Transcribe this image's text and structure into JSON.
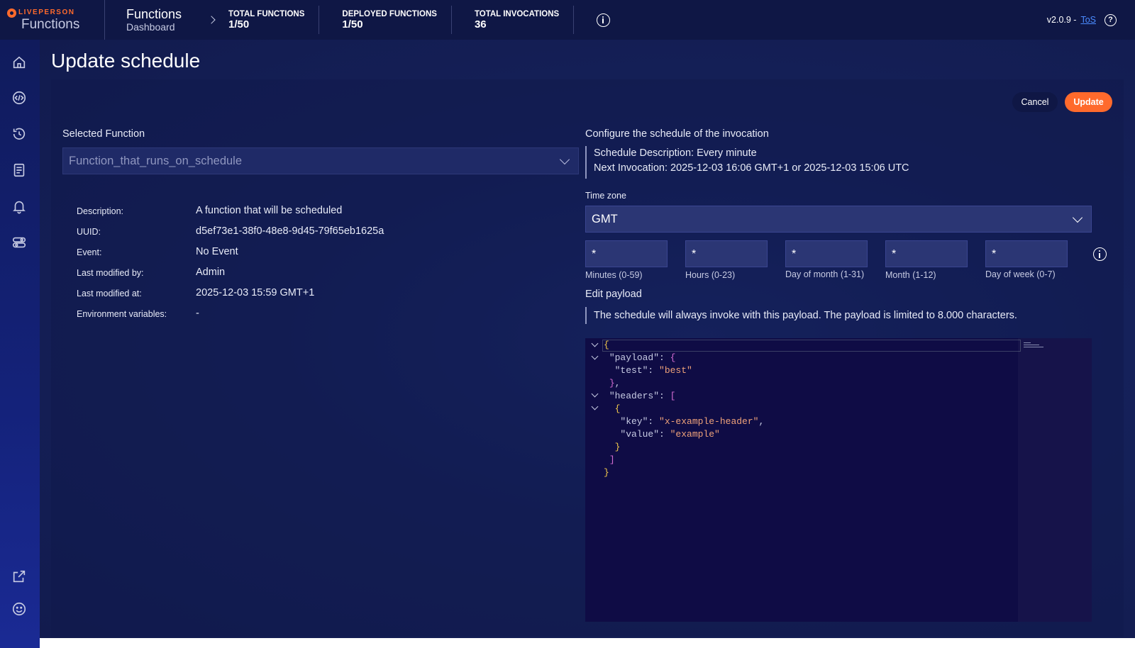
{
  "app": {
    "brand_word": "LIVEPERSON",
    "brand_name": "Functions",
    "version": "v2.0.9 -",
    "tos_label": "ToS"
  },
  "breadcrumb": {
    "title": "Functions",
    "subtitle": "Dashboard"
  },
  "stats": [
    {
      "label": "TOTAL FUNCTIONS",
      "value": "1/50"
    },
    {
      "label": "DEPLOYED FUNCTIONS",
      "value": "1/50"
    },
    {
      "label": "TOTAL INVOCATIONS",
      "value": "36"
    }
  ],
  "page": {
    "title": "Update schedule",
    "cancel_label": "Cancel",
    "update_label": "Update"
  },
  "function_section": {
    "label": "Selected Function",
    "selected_value": "Function_that_runs_on_schedule",
    "meta": [
      {
        "key": "Description:",
        "value": "A function that will be scheduled"
      },
      {
        "key": "UUID:",
        "value": "d5ef73e1-38f0-48e8-9d45-79f65eb1625a"
      },
      {
        "key": "Event:",
        "value": "No Event"
      },
      {
        "key": "Last modified by:",
        "value": "Admin"
      },
      {
        "key": "Last modified at:",
        "value": "2025-12-03 15:59 GMT+1"
      },
      {
        "key": "Environment variables:",
        "value": "-"
      }
    ]
  },
  "schedule_section": {
    "heading": "Configure the schedule of the invocation",
    "description_line": "Schedule Description: Every minute",
    "next_invocation_line": "Next Invocation: 2025-12-03 16:06 GMT+1 or 2025-12-03 15:06 UTC",
    "timezone_label": "Time zone",
    "timezone_value": "GMT",
    "cron_fields": [
      {
        "value": "*",
        "label": "Minutes (0-59)"
      },
      {
        "value": "*",
        "label": "Hours (0-23)"
      },
      {
        "value": "*",
        "label": "Day of month (1-31)"
      },
      {
        "value": "*",
        "label": "Month (1-12)"
      },
      {
        "value": "*",
        "label": "Day of week (0-7)"
      }
    ]
  },
  "payload_section": {
    "heading": "Edit payload",
    "note": "The schedule will always invoke with this payload. The payload is limited to 8.000 characters.",
    "code": {
      "payload_key": "\"payload\"",
      "test_key": "\"test\"",
      "test_value": "\"best\"",
      "headers_key": "\"headers\"",
      "key_key": "\"key\"",
      "key_value": "\"x-example-header\"",
      "value_key": "\"value\"",
      "value_value": "\"example\""
    }
  },
  "colors": {
    "accent": "#ff6a2c",
    "topbar": "#0f1745",
    "link": "#4b8cff"
  }
}
